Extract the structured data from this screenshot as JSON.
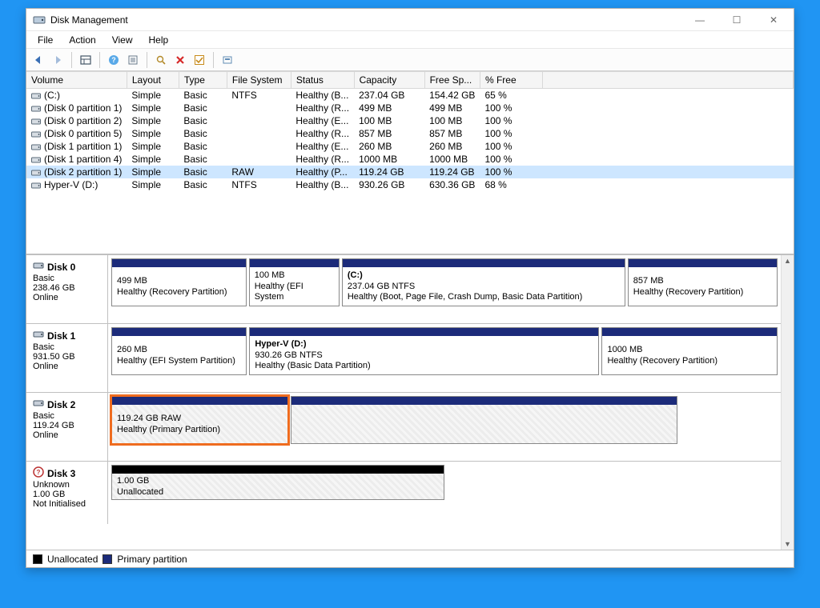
{
  "window": {
    "title": "Disk Management",
    "min_tip": "Minimise",
    "max_tip": "Maximise",
    "close_tip": "Close"
  },
  "menu": {
    "file": "File",
    "action": "Action",
    "view": "View",
    "help": "Help"
  },
  "toolbar": {
    "back": "Back",
    "forward": "Forward",
    "show_hide": "Show/Hide",
    "help": "Help",
    "props": "Properties",
    "explore": "Explore",
    "delete": "Delete",
    "mark_active": "Mark Active",
    "refresh": "Refresh"
  },
  "columns": {
    "volume": "Volume",
    "layout": "Layout",
    "type": "Type",
    "fs": "File System",
    "status": "Status",
    "capacity": "Capacity",
    "free": "Free Sp...",
    "pct": "% Free"
  },
  "volumes": [
    {
      "name": "(C:)",
      "layout": "Simple",
      "type": "Basic",
      "fs": "NTFS",
      "status": "Healthy (B...",
      "capacity": "237.04 GB",
      "free": "154.42 GB",
      "pct": "65 %",
      "selected": false
    },
    {
      "name": "(Disk 0 partition 1)",
      "layout": "Simple",
      "type": "Basic",
      "fs": "",
      "status": "Healthy (R...",
      "capacity": "499 MB",
      "free": "499 MB",
      "pct": "100 %",
      "selected": false
    },
    {
      "name": "(Disk 0 partition 2)",
      "layout": "Simple",
      "type": "Basic",
      "fs": "",
      "status": "Healthy (E...",
      "capacity": "100 MB",
      "free": "100 MB",
      "pct": "100 %",
      "selected": false
    },
    {
      "name": "(Disk 0 partition 5)",
      "layout": "Simple",
      "type": "Basic",
      "fs": "",
      "status": "Healthy (R...",
      "capacity": "857 MB",
      "free": "857 MB",
      "pct": "100 %",
      "selected": false
    },
    {
      "name": "(Disk 1 partition 1)",
      "layout": "Simple",
      "type": "Basic",
      "fs": "",
      "status": "Healthy (E...",
      "capacity": "260 MB",
      "free": "260 MB",
      "pct": "100 %",
      "selected": false
    },
    {
      "name": "(Disk 1 partition 4)",
      "layout": "Simple",
      "type": "Basic",
      "fs": "",
      "status": "Healthy (R...",
      "capacity": "1000 MB",
      "free": "1000 MB",
      "pct": "100 %",
      "selected": false
    },
    {
      "name": "(Disk 2 partition 1)",
      "layout": "Simple",
      "type": "Basic",
      "fs": "RAW",
      "status": "Healthy (P...",
      "capacity": "119.24 GB",
      "free": "119.24 GB",
      "pct": "100 %",
      "selected": true
    },
    {
      "name": "Hyper-V (D:)",
      "layout": "Simple",
      "type": "Basic",
      "fs": "NTFS",
      "status": "Healthy (B...",
      "capacity": "930.26 GB",
      "free": "630.36 GB",
      "pct": "68 %",
      "selected": false
    }
  ],
  "disks": [
    {
      "name": "Disk 0",
      "type": "Basic",
      "size": "238.46 GB",
      "state": "Online",
      "icon": "disk",
      "parts": [
        {
          "title": "",
          "line1": "499 MB",
          "line2": "Healthy (Recovery Partition)",
          "flex": 18,
          "bar": "primary"
        },
        {
          "title": "",
          "line1": "100 MB",
          "line2": "Healthy (EFI System",
          "flex": 12,
          "bar": "primary"
        },
        {
          "title": "(C:)",
          "line1": "237.04 GB NTFS",
          "line2": "Healthy (Boot, Page File, Crash Dump, Basic Data Partition)",
          "flex": 38,
          "bar": "primary",
          "bold": true
        },
        {
          "title": "",
          "line1": "857 MB",
          "line2": "Healthy (Recovery Partition)",
          "flex": 20,
          "bar": "primary"
        }
      ]
    },
    {
      "name": "Disk 1",
      "type": "Basic",
      "size": "931.50 GB",
      "state": "Online",
      "icon": "disk",
      "parts": [
        {
          "title": "",
          "line1": "260 MB",
          "line2": "Healthy (EFI System Partition)",
          "flex": 20,
          "bar": "primary"
        },
        {
          "title": "Hyper-V  (D:)",
          "line1": "930.26 GB NTFS",
          "line2": "Healthy (Basic Data Partition)",
          "flex": 52,
          "bar": "primary",
          "bold": true
        },
        {
          "title": "",
          "line1": "1000 MB",
          "line2": "Healthy (Recovery Partition)",
          "flex": 26,
          "bar": "primary"
        }
      ]
    },
    {
      "name": "Disk 2",
      "type": "Basic",
      "size": "119.24 GB",
      "state": "Online",
      "icon": "disk",
      "wrapflex": 85,
      "parts": [
        {
          "title": "",
          "line1": "119.24 GB RAW",
          "line2": "Healthy (Primary Partition)",
          "flex": 26,
          "bar": "primary",
          "hatch": true,
          "selected": true
        },
        {
          "title": "",
          "line1": "",
          "line2": "",
          "flex": 57,
          "bar": "primary",
          "hatch": true
        }
      ]
    },
    {
      "name": "Disk 3",
      "type": "Unknown",
      "size": "1.00 GB",
      "state": "Not Initialised",
      "icon": "disk-unknown",
      "wrapflex": 50,
      "short": true,
      "parts": [
        {
          "title": "",
          "line1": "1.00 GB",
          "line2": "Unallocated",
          "flex": 50,
          "bar": "unalloc",
          "hatch": true
        }
      ]
    }
  ],
  "legend": {
    "unallocated": "Unallocated",
    "primary": "Primary partition"
  }
}
